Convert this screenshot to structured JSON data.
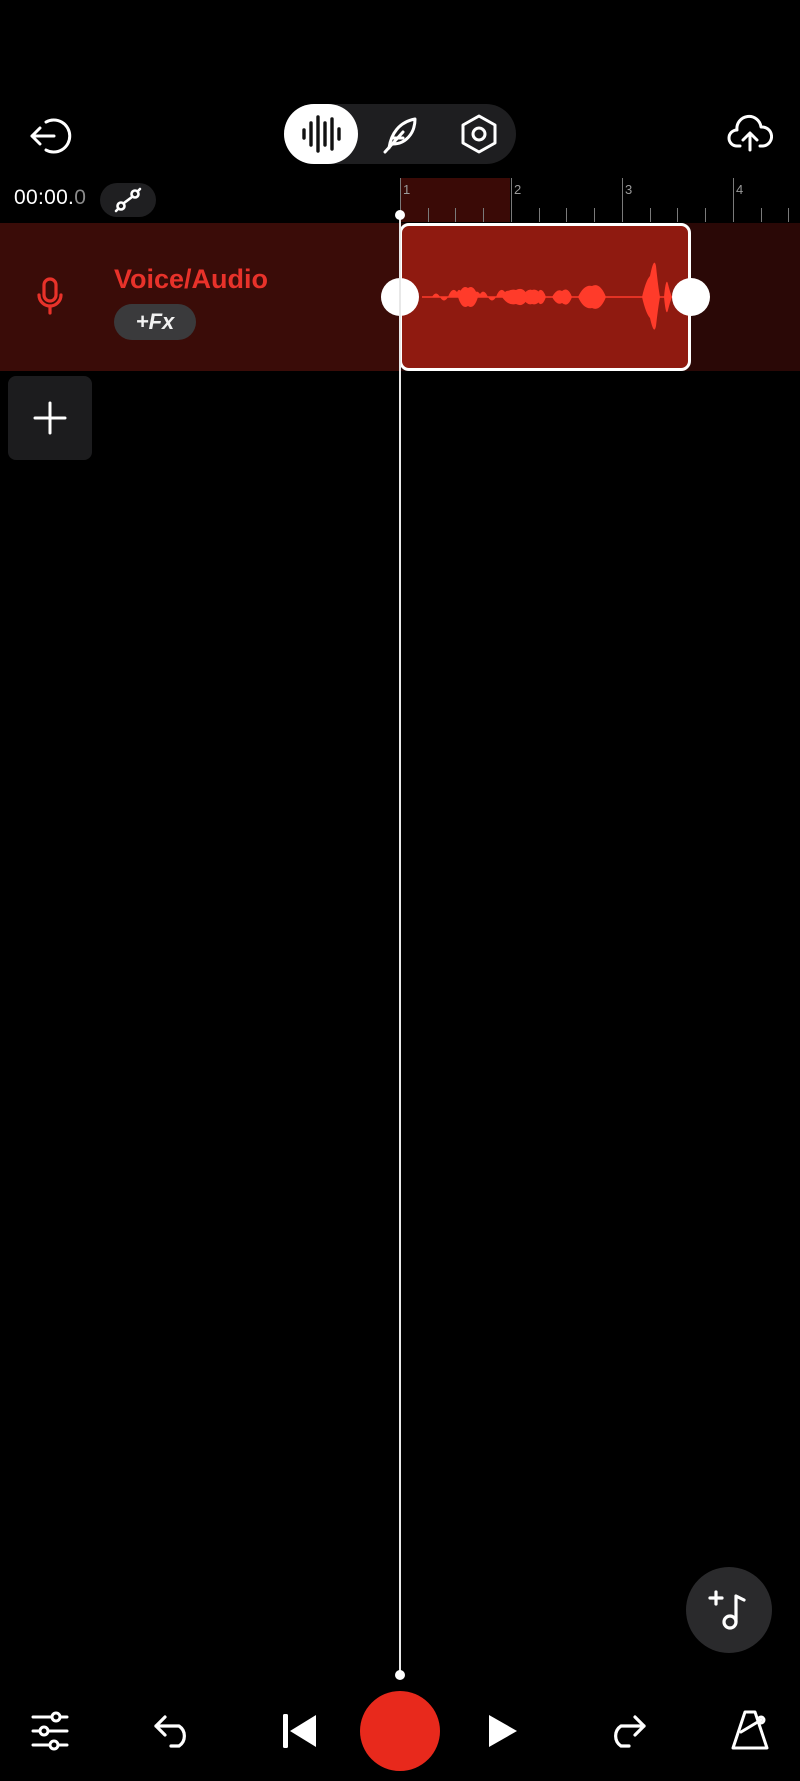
{
  "colors": {
    "accent_red": "#e8322a",
    "record_red": "#e8291c",
    "track_bg": "#2a0806",
    "clip_bg": "#8f1a10",
    "background": "#000000"
  },
  "header": {
    "exit_icon": "exit-icon",
    "modes": [
      {
        "name": "waveform-mode",
        "icon": "waveform-icon",
        "active": true
      },
      {
        "name": "feather-mode",
        "icon": "feather-icon",
        "active": false
      },
      {
        "name": "settings-mode",
        "icon": "hex-nut-icon",
        "active": false
      }
    ],
    "upload_icon": "cloud-upload-icon"
  },
  "timeline": {
    "time_main": "00:00.",
    "time_fraction": "0",
    "link_icon": "link-node-icon",
    "ruler_labels": [
      "1",
      "2",
      "3",
      "4"
    ]
  },
  "track": {
    "name": "Voice/Audio",
    "fx_label": "+Fx",
    "icon": "microphone-icon"
  },
  "add_track_icon": "plus-icon",
  "fab_icon": "add-music-note-icon",
  "bottom_bar": {
    "items": [
      "mixer-sliders-icon",
      "undo-icon",
      "skip-back-icon",
      "record-button",
      "play-icon",
      "redo-icon",
      "metronome-icon"
    ]
  }
}
